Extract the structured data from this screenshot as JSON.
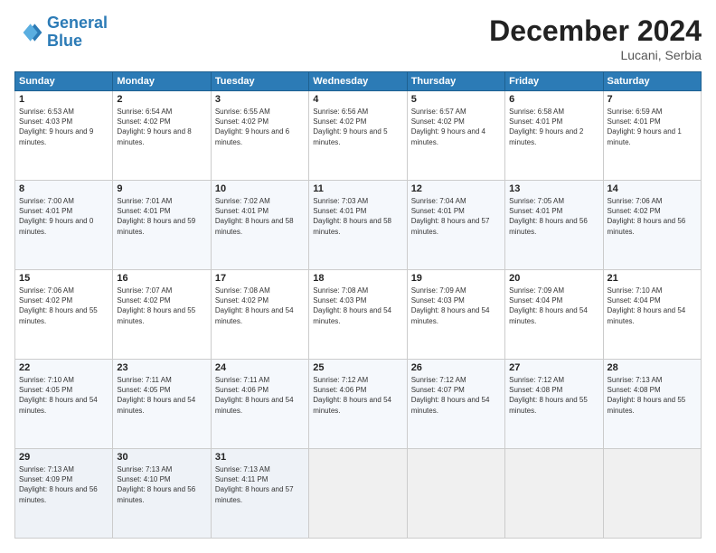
{
  "header": {
    "logo_line1": "General",
    "logo_line2": "Blue",
    "month": "December 2024",
    "location": "Lucani, Serbia"
  },
  "days_of_week": [
    "Sunday",
    "Monday",
    "Tuesday",
    "Wednesday",
    "Thursday",
    "Friday",
    "Saturday"
  ],
  "weeks": [
    [
      {
        "day": "1",
        "content": "Sunrise: 6:53 AM\nSunset: 4:03 PM\nDaylight: 9 hours and 9 minutes."
      },
      {
        "day": "2",
        "content": "Sunrise: 6:54 AM\nSunset: 4:02 PM\nDaylight: 9 hours and 8 minutes."
      },
      {
        "day": "3",
        "content": "Sunrise: 6:55 AM\nSunset: 4:02 PM\nDaylight: 9 hours and 6 minutes."
      },
      {
        "day": "4",
        "content": "Sunrise: 6:56 AM\nSunset: 4:02 PM\nDaylight: 9 hours and 5 minutes."
      },
      {
        "day": "5",
        "content": "Sunrise: 6:57 AM\nSunset: 4:02 PM\nDaylight: 9 hours and 4 minutes."
      },
      {
        "day": "6",
        "content": "Sunrise: 6:58 AM\nSunset: 4:01 PM\nDaylight: 9 hours and 2 minutes."
      },
      {
        "day": "7",
        "content": "Sunrise: 6:59 AM\nSunset: 4:01 PM\nDaylight: 9 hours and 1 minute."
      }
    ],
    [
      {
        "day": "8",
        "content": "Sunrise: 7:00 AM\nSunset: 4:01 PM\nDaylight: 9 hours and 0 minutes."
      },
      {
        "day": "9",
        "content": "Sunrise: 7:01 AM\nSunset: 4:01 PM\nDaylight: 8 hours and 59 minutes."
      },
      {
        "day": "10",
        "content": "Sunrise: 7:02 AM\nSunset: 4:01 PM\nDaylight: 8 hours and 58 minutes."
      },
      {
        "day": "11",
        "content": "Sunrise: 7:03 AM\nSunset: 4:01 PM\nDaylight: 8 hours and 58 minutes."
      },
      {
        "day": "12",
        "content": "Sunrise: 7:04 AM\nSunset: 4:01 PM\nDaylight: 8 hours and 57 minutes."
      },
      {
        "day": "13",
        "content": "Sunrise: 7:05 AM\nSunset: 4:01 PM\nDaylight: 8 hours and 56 minutes."
      },
      {
        "day": "14",
        "content": "Sunrise: 7:06 AM\nSunset: 4:02 PM\nDaylight: 8 hours and 56 minutes."
      }
    ],
    [
      {
        "day": "15",
        "content": "Sunrise: 7:06 AM\nSunset: 4:02 PM\nDaylight: 8 hours and 55 minutes."
      },
      {
        "day": "16",
        "content": "Sunrise: 7:07 AM\nSunset: 4:02 PM\nDaylight: 8 hours and 55 minutes."
      },
      {
        "day": "17",
        "content": "Sunrise: 7:08 AM\nSunset: 4:02 PM\nDaylight: 8 hours and 54 minutes."
      },
      {
        "day": "18",
        "content": "Sunrise: 7:08 AM\nSunset: 4:03 PM\nDaylight: 8 hours and 54 minutes."
      },
      {
        "day": "19",
        "content": "Sunrise: 7:09 AM\nSunset: 4:03 PM\nDaylight: 8 hours and 54 minutes."
      },
      {
        "day": "20",
        "content": "Sunrise: 7:09 AM\nSunset: 4:04 PM\nDaylight: 8 hours and 54 minutes."
      },
      {
        "day": "21",
        "content": "Sunrise: 7:10 AM\nSunset: 4:04 PM\nDaylight: 8 hours and 54 minutes."
      }
    ],
    [
      {
        "day": "22",
        "content": "Sunrise: 7:10 AM\nSunset: 4:05 PM\nDaylight: 8 hours and 54 minutes."
      },
      {
        "day": "23",
        "content": "Sunrise: 7:11 AM\nSunset: 4:05 PM\nDaylight: 8 hours and 54 minutes."
      },
      {
        "day": "24",
        "content": "Sunrise: 7:11 AM\nSunset: 4:06 PM\nDaylight: 8 hours and 54 minutes."
      },
      {
        "day": "25",
        "content": "Sunrise: 7:12 AM\nSunset: 4:06 PM\nDaylight: 8 hours and 54 minutes."
      },
      {
        "day": "26",
        "content": "Sunrise: 7:12 AM\nSunset: 4:07 PM\nDaylight: 8 hours and 54 minutes."
      },
      {
        "day": "27",
        "content": "Sunrise: 7:12 AM\nSunset: 4:08 PM\nDaylight: 8 hours and 55 minutes."
      },
      {
        "day": "28",
        "content": "Sunrise: 7:13 AM\nSunset: 4:08 PM\nDaylight: 8 hours and 55 minutes."
      }
    ],
    [
      {
        "day": "29",
        "content": "Sunrise: 7:13 AM\nSunset: 4:09 PM\nDaylight: 8 hours and 56 minutes."
      },
      {
        "day": "30",
        "content": "Sunrise: 7:13 AM\nSunset: 4:10 PM\nDaylight: 8 hours and 56 minutes."
      },
      {
        "day": "31",
        "content": "Sunrise: 7:13 AM\nSunset: 4:11 PM\nDaylight: 8 hours and 57 minutes."
      },
      {
        "day": "",
        "content": ""
      },
      {
        "day": "",
        "content": ""
      },
      {
        "day": "",
        "content": ""
      },
      {
        "day": "",
        "content": ""
      }
    ]
  ]
}
